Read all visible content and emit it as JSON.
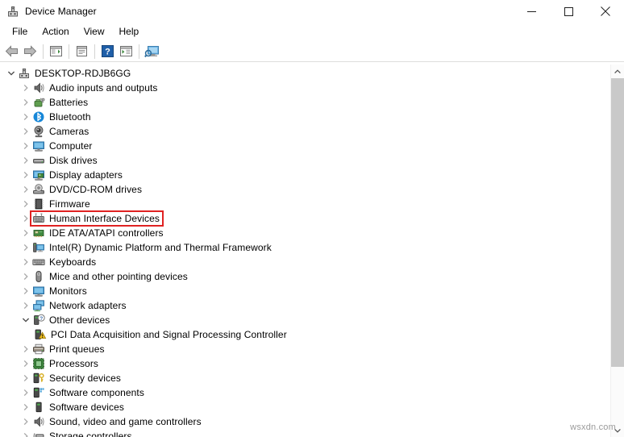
{
  "window": {
    "title": "Device Manager",
    "icon": "device-manager-icon",
    "controls": {
      "minimize": "minimize-button",
      "maximize": "maximize-button",
      "close": "close-button"
    }
  },
  "menubar": {
    "items": [
      {
        "label": "File"
      },
      {
        "label": "Action"
      },
      {
        "label": "View"
      },
      {
        "label": "Help"
      }
    ]
  },
  "toolbar": {
    "buttons": [
      {
        "name": "back-arrow-icon",
        "tooltip": "Back"
      },
      {
        "name": "forward-arrow-icon",
        "tooltip": "Forward"
      },
      {
        "name": "show-hide-console-tree-icon",
        "tooltip": "Show/Hide Console Tree"
      },
      {
        "name": "properties-icon",
        "tooltip": "Properties"
      },
      {
        "name": "help-icon",
        "tooltip": "Help"
      },
      {
        "name": "update-driver-icon",
        "tooltip": "Update Driver Software"
      },
      {
        "name": "scan-for-hardware-changes-icon",
        "tooltip": "Scan for hardware changes"
      }
    ]
  },
  "tree": {
    "root": {
      "label": "DESKTOP-RDJB6GG",
      "icon": "computer-node-icon",
      "expanded": true,
      "level": 0
    },
    "nodes": [
      {
        "label": "Audio inputs and outputs",
        "icon": "speaker-icon",
        "expanded": false,
        "level": 1,
        "highlighted": false
      },
      {
        "label": "Batteries",
        "icon": "battery-icon",
        "expanded": false,
        "level": 1,
        "highlighted": false
      },
      {
        "label": "Bluetooth",
        "icon": "bluetooth-icon",
        "expanded": false,
        "level": 1,
        "highlighted": false
      },
      {
        "label": "Cameras",
        "icon": "camera-icon",
        "expanded": false,
        "level": 1,
        "highlighted": false
      },
      {
        "label": "Computer",
        "icon": "monitor-icon",
        "expanded": false,
        "level": 1,
        "highlighted": false
      },
      {
        "label": "Disk drives",
        "icon": "disk-drive-icon",
        "expanded": false,
        "level": 1,
        "highlighted": false
      },
      {
        "label": "Display adapters",
        "icon": "display-adapter-icon",
        "expanded": false,
        "level": 1,
        "highlighted": false
      },
      {
        "label": "DVD/CD-ROM drives",
        "icon": "optical-drive-icon",
        "expanded": false,
        "level": 1,
        "highlighted": false
      },
      {
        "label": "Firmware",
        "icon": "firmware-chip-icon",
        "expanded": false,
        "level": 1,
        "highlighted": false
      },
      {
        "label": "Human Interface Devices",
        "icon": "hid-keyboard-icon",
        "expanded": false,
        "level": 1,
        "highlighted": true
      },
      {
        "label": "IDE ATA/ATAPI controllers",
        "icon": "ide-controller-icon",
        "expanded": false,
        "level": 1,
        "highlighted": false
      },
      {
        "label": "Intel(R) Dynamic Platform and Thermal Framework",
        "icon": "platform-framework-icon",
        "expanded": false,
        "level": 1,
        "highlighted": false
      },
      {
        "label": "Keyboards",
        "icon": "keyboard-icon",
        "expanded": false,
        "level": 1,
        "highlighted": false
      },
      {
        "label": "Mice and other pointing devices",
        "icon": "mouse-icon",
        "expanded": false,
        "level": 1,
        "highlighted": false
      },
      {
        "label": "Monitors",
        "icon": "monitor-icon",
        "expanded": false,
        "level": 1,
        "highlighted": false
      },
      {
        "label": "Network adapters",
        "icon": "network-adapter-icon",
        "expanded": false,
        "level": 1,
        "highlighted": false
      },
      {
        "label": "Other devices",
        "icon": "other-device-question-icon",
        "expanded": true,
        "level": 1,
        "highlighted": false
      },
      {
        "label": "PCI Data Acquisition and Signal Processing Controller",
        "icon": "unknown-device-warning-icon",
        "expanded": null,
        "level": 2,
        "highlighted": false
      },
      {
        "label": "Print queues",
        "icon": "printer-icon",
        "expanded": false,
        "level": 1,
        "highlighted": false
      },
      {
        "label": "Processors",
        "icon": "processor-icon",
        "expanded": false,
        "level": 1,
        "highlighted": false
      },
      {
        "label": "Security devices",
        "icon": "security-key-icon",
        "expanded": false,
        "level": 1,
        "highlighted": false
      },
      {
        "label": "Software components",
        "icon": "software-component-icon",
        "expanded": false,
        "level": 1,
        "highlighted": false
      },
      {
        "label": "Software devices",
        "icon": "software-device-icon",
        "expanded": false,
        "level": 1,
        "highlighted": false
      },
      {
        "label": "Sound, video and game controllers",
        "icon": "speaker-icon",
        "expanded": false,
        "level": 1,
        "highlighted": false
      },
      {
        "label": "Storage controllers",
        "icon": "storage-controller-icon",
        "expanded": false,
        "level": 1,
        "highlighted": false
      }
    ]
  },
  "annotation": {
    "target_label": "Human Interface Devices",
    "color": "#e02222"
  },
  "scrollbar": {
    "up_arrow": "scroll-up-arrow-icon",
    "down_arrow": "scroll-down-arrow-icon",
    "thumb": "scrollbar-thumb"
  },
  "watermark": {
    "text": "wsxdn.com"
  },
  "colors": {
    "accent": "#0078d7",
    "highlight": "#e02222",
    "text": "#000000",
    "window_bg": "#ffffff",
    "scrollbar_thumb": "#c9c9c9"
  }
}
